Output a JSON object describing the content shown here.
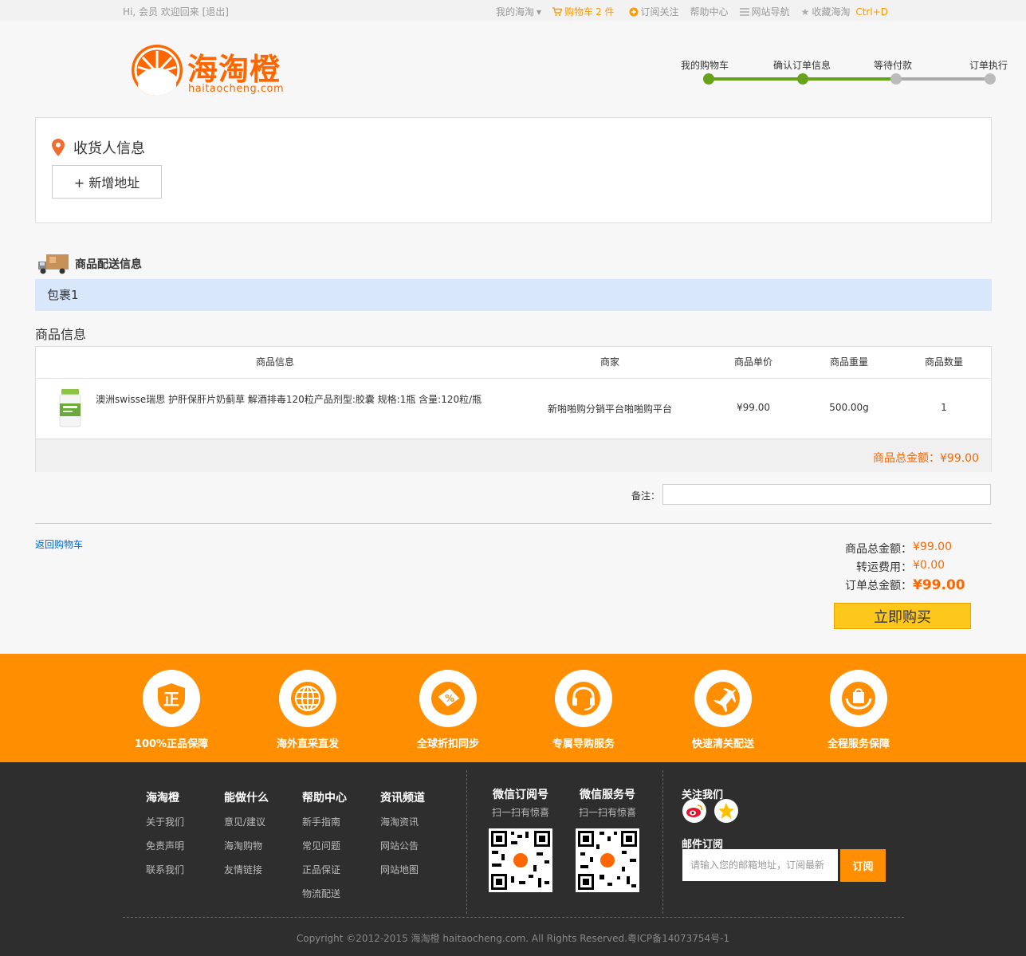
{
  "topbar": {
    "greeting": "Hi, 会员 欢迎回来 [退出]",
    "my_haitao": "我的海淘",
    "cart_label": "购物车",
    "cart_count": "2 件",
    "subscribe": "订阅关注",
    "help": "帮助中心",
    "site_nav": "网站导航",
    "favorite": "收藏海淘",
    "shortcut": "Ctrl+D"
  },
  "logo": {
    "title": "海淘橙",
    "subtitle": "haitaocheng.com"
  },
  "steps": [
    "我的购物车",
    "确认订单信息",
    "等待付款",
    "订单执行"
  ],
  "steps_done": 2,
  "address": {
    "heading": "收货人信息",
    "add_button": "+ 新增地址"
  },
  "shipping": {
    "heading": "商品配送信息",
    "package": "包裹1"
  },
  "goods": {
    "heading": "商品信息",
    "columns": [
      "商品信息",
      "商家",
      "商品单价",
      "商品重量",
      "商品数量"
    ],
    "items": [
      {
        "name": "澳洲swisse瑞思 护肝保肝片奶蓟草 解酒排毒120粒产品剂型:胶囊 规格:1瓶 含量:120粒/瓶",
        "merchant": "新啪啪购分销平台啪啪购平台",
        "price": "¥99.00",
        "weight": "500.00g",
        "quantity": "1"
      }
    ],
    "subtotal": "商品总金额：¥99.00"
  },
  "remark_label": "备注：",
  "back_link": "返回购物车",
  "totals": {
    "goods_label": "商品总金额：",
    "goods_value": "¥99.00",
    "shipping_label": "转运费用：",
    "shipping_value": "¥0.00",
    "order_label": "订单总金额：",
    "order_value": "¥99.00"
  },
  "buy_button": "立即购买",
  "services": [
    "100%正品保障",
    "海外直采直发",
    "全球折扣同步",
    "专属导购服务",
    "快速清关配送",
    "全程服务保障"
  ],
  "footer": {
    "columns": [
      {
        "title": "海淘橙",
        "items": [
          "关于我们",
          "免责声明",
          "联系我们"
        ]
      },
      {
        "title": "能做什么",
        "items": [
          "意见/建议",
          "海淘购物",
          "友情链接"
        ]
      },
      {
        "title": "帮助中心",
        "items": [
          "新手指南",
          "常见问题",
          "正品保证",
          "物流配送"
        ]
      },
      {
        "title": "资讯频道",
        "items": [
          "海淘资讯",
          "网站公告",
          "网站地图"
        ]
      }
    ],
    "qr": [
      {
        "title": "微信订阅号",
        "sub": "扫一扫有惊喜"
      },
      {
        "title": "微信服务号",
        "sub": "扫一扫有惊喜"
      }
    ],
    "follow": "关注我们",
    "mail_heading": "邮件订阅",
    "mail_placeholder": "请输入您的邮箱地址，订阅最新",
    "mail_button": "订阅",
    "copyright": "Copyright ©2012-2015 海淘橙 haitaocheng.com. All Rights Reserved.粤ICP备14073754号-1"
  },
  "colors": {
    "accent": "#ff8f00",
    "brand": "#ff6600",
    "progress": "#66a31a",
    "link": "#0066cc"
  }
}
